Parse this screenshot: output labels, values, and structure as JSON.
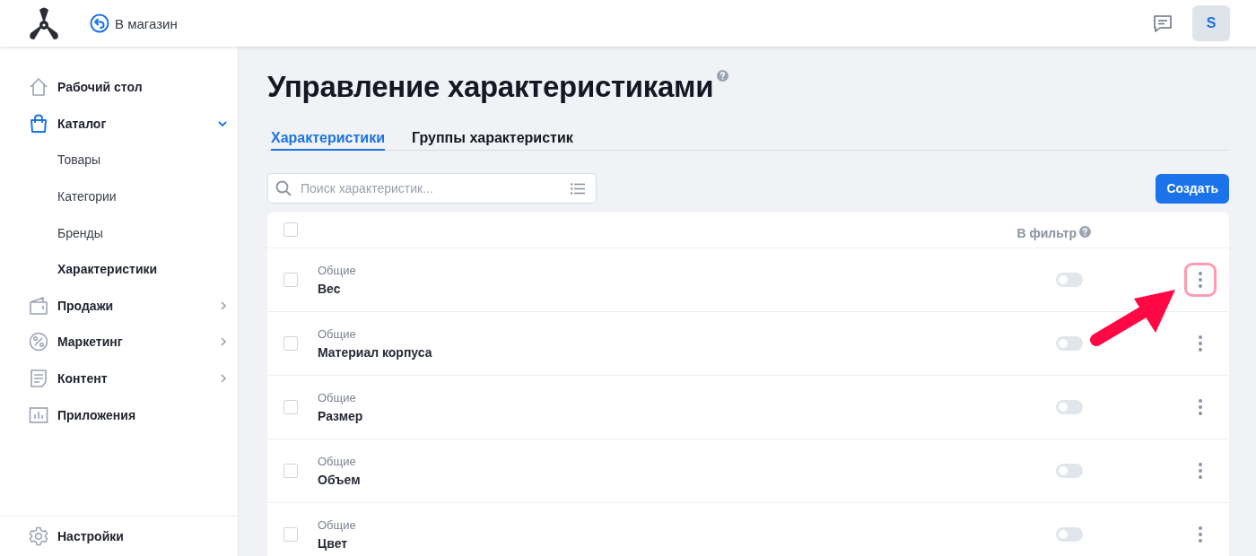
{
  "topbar": {
    "store_link": "В магазин",
    "avatar": "S"
  },
  "sidebar": {
    "items": [
      {
        "label": "Рабочий стол",
        "selected": false
      },
      {
        "label": "Каталог",
        "selected": true,
        "expanded": true,
        "children": [
          {
            "label": "Товары",
            "selected": false
          },
          {
            "label": "Категории",
            "selected": false
          },
          {
            "label": "Бренды",
            "selected": false
          },
          {
            "label": "Характеристики",
            "selected": true
          }
        ]
      },
      {
        "label": "Продажи",
        "selected": false,
        "expanded": false
      },
      {
        "label": "Маркетинг",
        "selected": false,
        "expanded": false
      },
      {
        "label": "Контент",
        "selected": false,
        "expanded": false
      },
      {
        "label": "Приложения",
        "selected": false
      }
    ],
    "footer_item": {
      "label": "Настройки"
    }
  },
  "page": {
    "title": "Управление характеристиками",
    "tabs": [
      {
        "label": "Характеристики",
        "selected": true
      },
      {
        "label": "Группы характеристик",
        "selected": false
      }
    ],
    "search": {
      "placeholder": "Поиск характеристик..."
    },
    "create_button": "Создать",
    "table": {
      "columns": [
        "В фильтр"
      ],
      "header_checked": false,
      "rows": [
        {
          "group": "Общие",
          "name": "Вес",
          "checked": false,
          "in_filter": false,
          "highlighted": true
        },
        {
          "group": "Общие",
          "name": "Материал корпуса",
          "checked": false,
          "in_filter": false,
          "highlighted": false
        },
        {
          "group": "Общие",
          "name": "Размер",
          "checked": false,
          "in_filter": false,
          "highlighted": false
        },
        {
          "group": "Общие",
          "name": "Объем",
          "checked": false,
          "in_filter": false,
          "highlighted": false
        },
        {
          "group": "Общие",
          "name": "Цвет",
          "checked": false,
          "in_filter": false,
          "highlighted": false
        }
      ]
    }
  }
}
